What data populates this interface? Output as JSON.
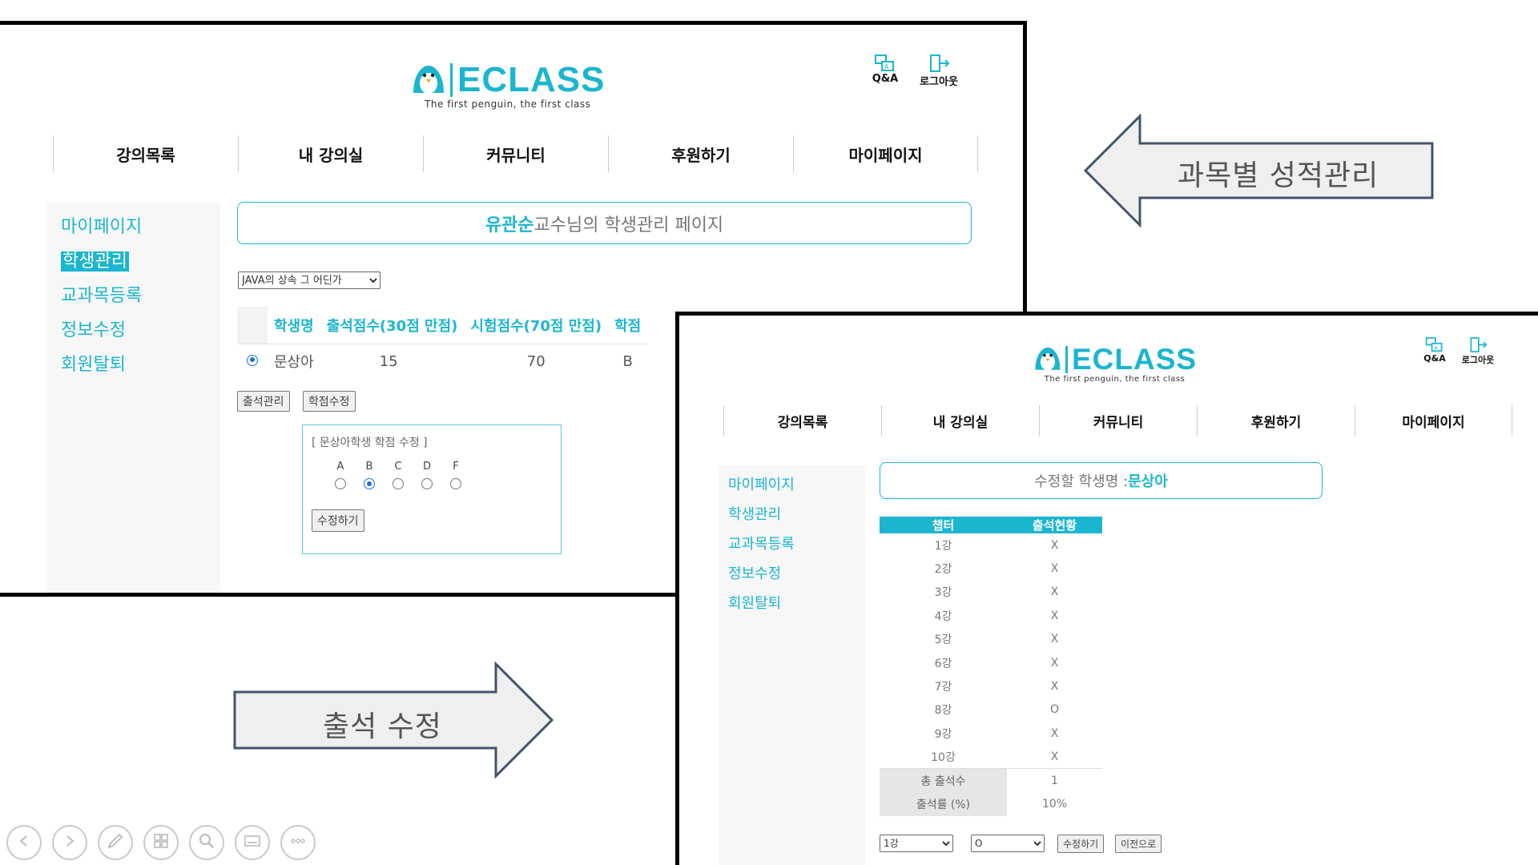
{
  "screen1": {
    "logo": {
      "text": "ECLASS",
      "tagline": "The first penguin, the first class"
    },
    "top_icons": {
      "qa": "Q&A",
      "logout": "로그아웃"
    },
    "nav": [
      "강의목록",
      "내 강의실",
      "커뮤니티",
      "후원하기",
      "마이페이지"
    ],
    "sidebar": [
      "마이페이지",
      "학생관리",
      "교과목등록",
      "정보수정",
      "회원탈퇴"
    ],
    "sidebar_active": "학생관리",
    "title": {
      "name": "유관순",
      "suffix": "교수님의 학생관리 페이지"
    },
    "course_select": "JAVA의 상속 그 어딘가",
    "table": {
      "headers": [
        "학생명",
        "출석점수(30점 만점)",
        "시험점수(70점 만점)",
        "학점"
      ],
      "rows": [
        {
          "name": "문상아",
          "attendance": "15",
          "exam": "70",
          "grade": "B"
        }
      ]
    },
    "buttons": {
      "attendance": "출석관리",
      "grade": "학점수정"
    },
    "edit_box": {
      "title": "[ 문상아학생 학점 수정 ]",
      "grades": [
        "A",
        "B",
        "C",
        "D",
        "F"
      ],
      "selected": "B",
      "submit": "수정하기"
    }
  },
  "arrows": {
    "grade_label": "과목별 성적관리",
    "attendance_label": "출석 수정"
  },
  "screen2": {
    "logo": {
      "text": "ECLASS",
      "tagline": "The first penguin, the first class"
    },
    "top_icons": {
      "qa": "Q&A",
      "logout": "로그아웃"
    },
    "nav": [
      "강의목록",
      "내 강의실",
      "커뮤니티",
      "후원하기",
      "마이페이지"
    ],
    "sidebar": [
      "마이페이지",
      "학생관리",
      "교과목등록",
      "정보수정",
      "회원탈퇴"
    ],
    "title": {
      "prefix": "수정할 학생명 : ",
      "name": "문상아"
    },
    "table": {
      "headers": [
        "챕터",
        "출석현황"
      ],
      "rows": [
        [
          "1강",
          "X"
        ],
        [
          "2강",
          "X"
        ],
        [
          "3강",
          "X"
        ],
        [
          "4강",
          "X"
        ],
        [
          "5강",
          "X"
        ],
        [
          "6강",
          "X"
        ],
        [
          "7강",
          "X"
        ],
        [
          "8강",
          "O"
        ],
        [
          "9강",
          "X"
        ],
        [
          "10강",
          "X"
        ]
      ],
      "total_label": "총 출석수",
      "total_value": "1",
      "rate_label": "출석률 (%)",
      "rate_value": "10%"
    },
    "controls": {
      "chapter": "1강",
      "status": "O",
      "submit": "수정하기",
      "back": "이전으로"
    }
  },
  "colors": {
    "accent": "#1cb5cf",
    "frame": "#000000",
    "arrow_fill": "#efefef",
    "arrow_stroke": "#44546a"
  },
  "toolbar_icons": [
    "prev-icon",
    "next-icon",
    "pen-icon",
    "slides-icon",
    "zoom-icon",
    "subtitle-icon",
    "more-icon"
  ]
}
